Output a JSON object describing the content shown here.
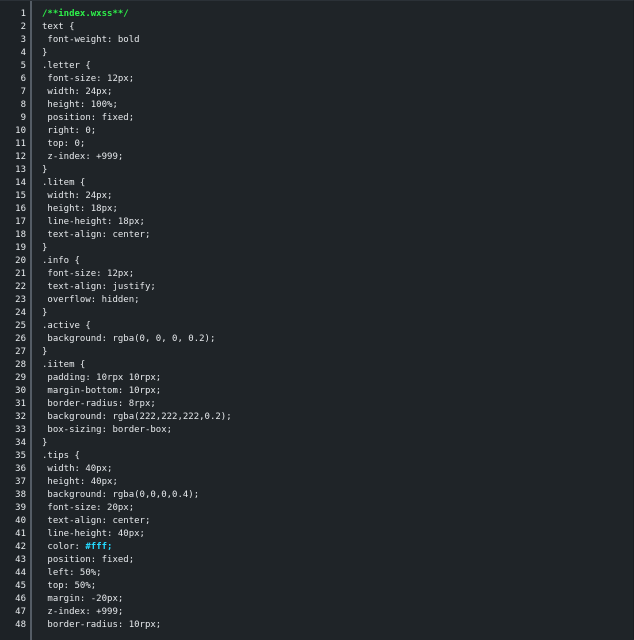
{
  "editor": {
    "lines": [
      {
        "n": "1",
        "text": "/**index.wxss**/",
        "kind": "comment"
      },
      {
        "n": "2",
        "text": "text {"
      },
      {
        "n": "3",
        "text": " font-weight: bold"
      },
      {
        "n": "4",
        "text": "}"
      },
      {
        "n": "5",
        "text": ".letter {"
      },
      {
        "n": "6",
        "text": " font-size: 12px;"
      },
      {
        "n": "7",
        "text": " width: 24px;"
      },
      {
        "n": "8",
        "text": " height: 100%;"
      },
      {
        "n": "9",
        "text": " position: fixed;"
      },
      {
        "n": "10",
        "text": " right: 0;"
      },
      {
        "n": "11",
        "text": " top: 0;"
      },
      {
        "n": "12",
        "text": " z-index: +999;"
      },
      {
        "n": "13",
        "text": "}"
      },
      {
        "n": "14",
        "text": ".litem {"
      },
      {
        "n": "15",
        "text": " width: 24px;"
      },
      {
        "n": "16",
        "text": " height: 18px;"
      },
      {
        "n": "17",
        "text": " line-height: 18px;"
      },
      {
        "n": "18",
        "text": " text-align: center;"
      },
      {
        "n": "19",
        "text": "}"
      },
      {
        "n": "20",
        "text": ".info {"
      },
      {
        "n": "21",
        "text": " font-size: 12px;"
      },
      {
        "n": "22",
        "text": " text-align: justify;"
      },
      {
        "n": "23",
        "text": " overflow: hidden;"
      },
      {
        "n": "24",
        "text": "}"
      },
      {
        "n": "25",
        "text": ".active {"
      },
      {
        "n": "26",
        "text": " background: rgba(0, 0, 0, 0.2);"
      },
      {
        "n": "27",
        "text": "}"
      },
      {
        "n": "28",
        "text": ".iitem {"
      },
      {
        "n": "29",
        "text": " padding: 10rpx 10rpx;"
      },
      {
        "n": "30",
        "text": " margin-bottom: 10rpx;"
      },
      {
        "n": "31",
        "text": " border-radius: 8rpx;"
      },
      {
        "n": "32",
        "text": " background: rgba(222,222,222,0.2);"
      },
      {
        "n": "33",
        "text": " box-sizing: border-box;"
      },
      {
        "n": "34",
        "text": "}"
      },
      {
        "n": "35",
        "text": ".tips {"
      },
      {
        "n": "36",
        "text": " width: 40px;"
      },
      {
        "n": "37",
        "text": " height: 40px;"
      },
      {
        "n": "38",
        "text": " background: rgba(0,0,0,0.4);"
      },
      {
        "n": "39",
        "text": " font-size: 20px;"
      },
      {
        "n": "40",
        "text": " text-align: center;"
      },
      {
        "n": "41",
        "text": " line-height: 40px;"
      },
      {
        "n": "42",
        "prefix": " color: ",
        "highlight": "#fff;",
        "kind": "hex"
      },
      {
        "n": "43",
        "text": " position: fixed;"
      },
      {
        "n": "44",
        "text": " left: 50%;"
      },
      {
        "n": "45",
        "text": " top: 50%;"
      },
      {
        "n": "46",
        "text": " margin: -20px;"
      },
      {
        "n": "47",
        "text": " z-index: +999;"
      },
      {
        "n": "48",
        "text": " border-radius: 10rpx;"
      }
    ]
  },
  "colors": {
    "background": "#1f2428",
    "gutter_border": "#555d66",
    "comment": "#2ef04a",
    "hex_literal": "#24d9ff",
    "text": "#e6e9ec"
  }
}
